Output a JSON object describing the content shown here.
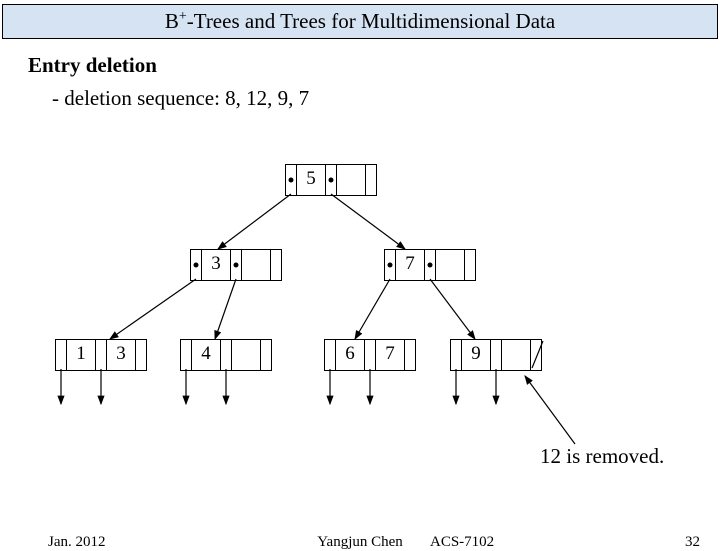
{
  "title_prefix": "B",
  "title_super": "+",
  "title_rest": "-Trees and Trees for Multidimensional Data",
  "heading": "Entry deletion",
  "subline": "- deletion sequence: 8, 12, 9, 7",
  "tree": {
    "root": {
      "keys": [
        "5"
      ]
    },
    "internal": [
      {
        "keys": [
          "3"
        ]
      },
      {
        "keys": [
          "7"
        ]
      }
    ],
    "leaves": [
      {
        "keys": [
          "1",
          "3"
        ]
      },
      {
        "keys": [
          "4",
          ""
        ]
      },
      {
        "keys": [
          "6",
          "7"
        ]
      },
      {
        "keys": [
          "9",
          ""
        ]
      }
    ]
  },
  "annotation": "12 is removed.",
  "footer": {
    "left": "Jan. 2012",
    "center": "Yangjun Chen",
    "right_course": "ACS-7102",
    "right_page": "32"
  }
}
